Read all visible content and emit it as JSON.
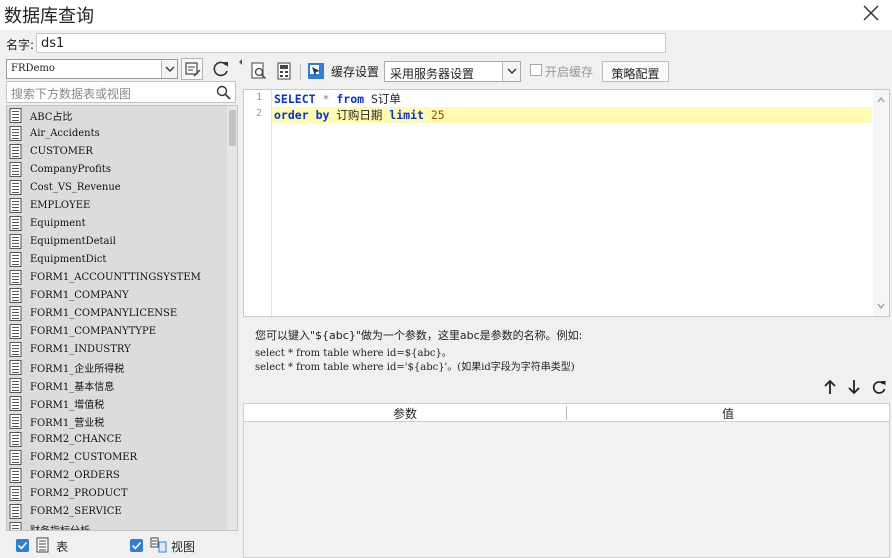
{
  "window": {
    "title": "数据库查询",
    "close_icon": "close-icon"
  },
  "name_row": {
    "label": "名字:",
    "value": "ds1"
  },
  "left": {
    "database": "FRDemo",
    "search_placeholder": "搜索下方数据表或视图",
    "tables": [
      "ABC占比",
      "Air_Accidents",
      "CUSTOMER",
      "CompanyProfits",
      "Cost_VS_Revenue",
      "EMPLOYEE",
      "Equipment",
      "EquipmentDetail",
      "EquipmentDict",
      "FORM1_ACCOUNTTINGSYSTEM",
      "FORM1_COMPANY",
      "FORM1_COMPANYLICENSE",
      "FORM1_COMPANYTYPE",
      "FORM1_INDUSTRY",
      "FORM1_企业所得税",
      "FORM1_基本信息",
      "FORM1_增值税",
      "FORM1_营业税",
      "FORM2_CHANCE",
      "FORM2_CUSTOMER",
      "FORM2_ORDERS",
      "FORM2_PRODUCT",
      "FORM2_SERVICE",
      "财务指标分析"
    ],
    "footer": {
      "table_label": "表",
      "view_label": "视图",
      "table_checked": true,
      "view_checked": true
    }
  },
  "toolbar": {
    "cache_label": "缓存设置",
    "cache_value": "采用服务器设置",
    "enable_cache_label": "开启缓存",
    "strategy_button": "策略配置"
  },
  "editor": {
    "line_numbers": [
      "1",
      "2"
    ],
    "line1": {
      "kw1": "SELECT",
      "op": "*",
      "kw2": "from",
      "ident": "S订单"
    },
    "line2": {
      "kw1": "order",
      "kw2": "by",
      "ident": "订购日期",
      "kw3": "limit",
      "num": "25"
    }
  },
  "hint": {
    "line1": "您可以键入\"${abc}\"做为一个参数，这里abc是参数的名称。例如:",
    "line2": "select * from table where id=${abc}。",
    "line3": "select * from table where id='${abc}'。(如果id字段为字符串类型)"
  },
  "params": {
    "col_param": "参数",
    "col_value": "值"
  },
  "colors": {
    "keyword": "#0b2fd8",
    "highlight_line": "#fffbb0",
    "checkbox": "#2f7fd5"
  }
}
